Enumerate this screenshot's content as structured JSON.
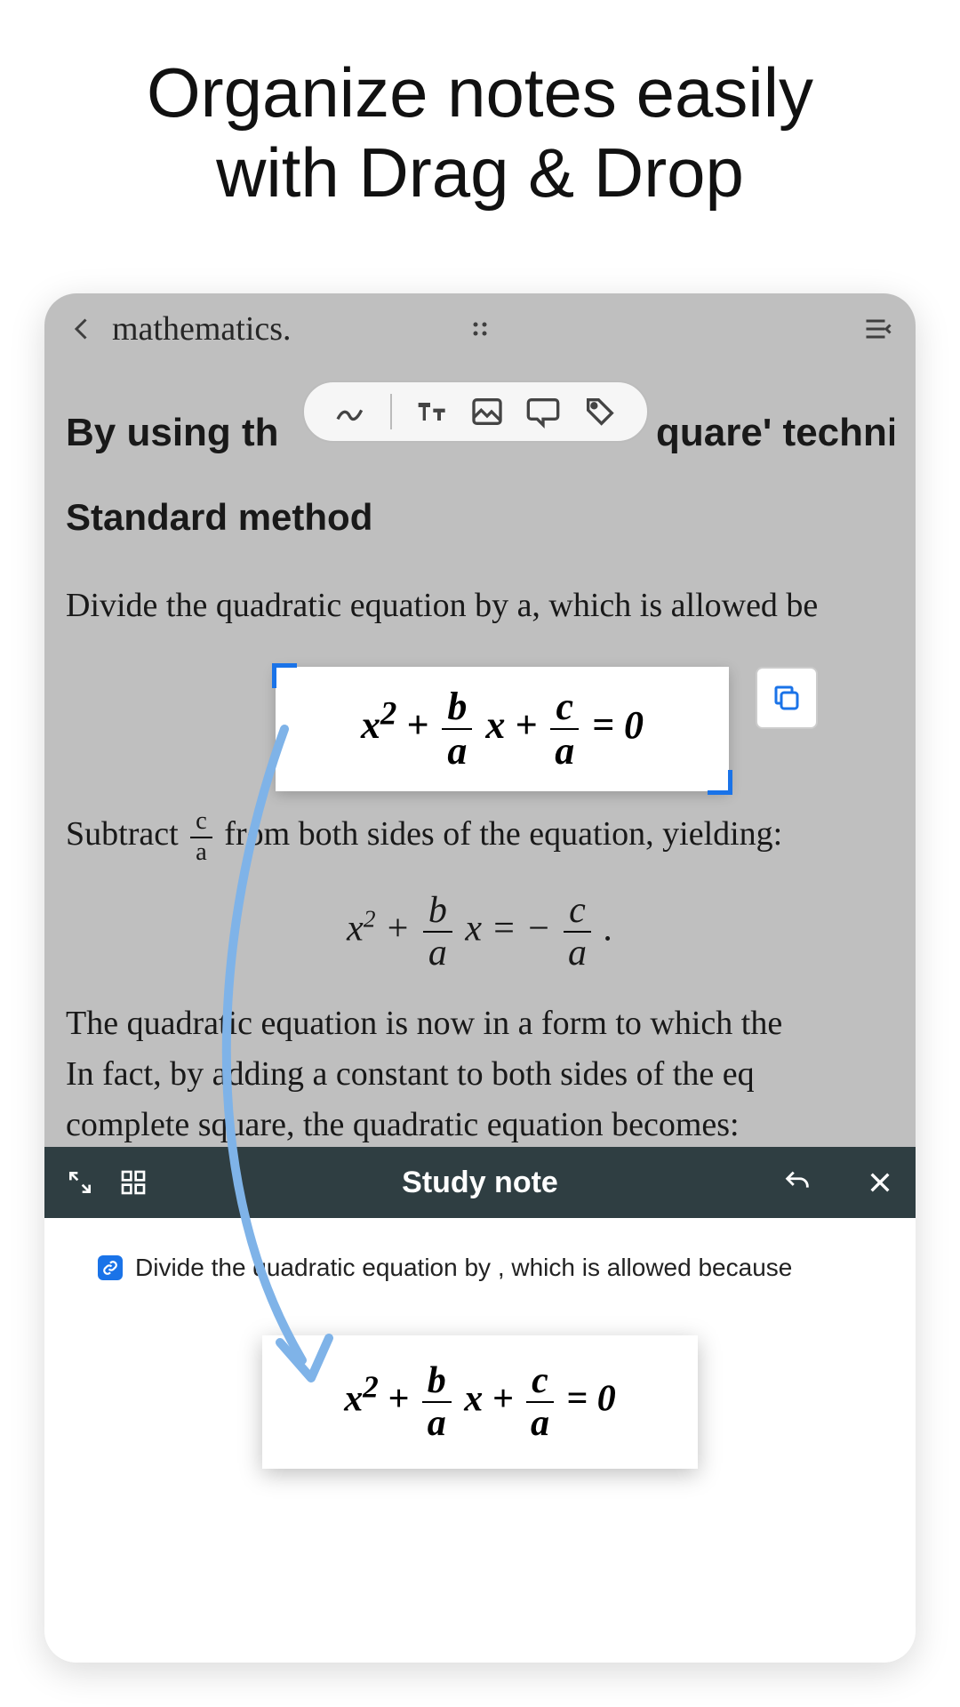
{
  "promo": {
    "line1": "Organize notes easily",
    "line2": "with Drag & Drop"
  },
  "appbar": {
    "title": "mathematics."
  },
  "content": {
    "lead_before": "By using th",
    "lead_after": "quare' technique",
    "heading": "Standard method",
    "para1": "Divide the quadratic equation by a, which is allowed be",
    "para2_before": "Subtract",
    "para2_after": "from both sides of the equation, yielding:",
    "para3_l1": "The quadratic equation is now in a form to which the",
    "para3_l2": "In fact, by adding a constant to both sides of the eq",
    "para3_l3": "complete square, the quadratic equation becomes:"
  },
  "eq": {
    "x2": "x",
    "sup2": "2",
    "plus": " + ",
    "b": "b",
    "a": "a",
    "c": "c",
    "x": "x",
    "eq0": " = 0",
    "eqminus": " = −",
    "dot": "  ."
  },
  "studybar": {
    "label": "Study note"
  },
  "note": {
    "text": "Divide the quadratic equation by , which is allowed because"
  }
}
